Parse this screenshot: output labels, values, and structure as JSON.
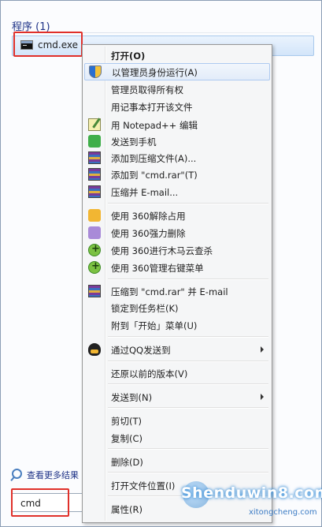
{
  "start_menu": {
    "section_header": "程序 (1)",
    "result_item": "cmd.exe",
    "see_more": "查看更多结果",
    "search_value": "cmd"
  },
  "context_menu": {
    "items": [
      {
        "label": "打开(O)",
        "icon": "",
        "bold": true
      },
      {
        "label": "以管理员身份运行(A)",
        "icon": "uac-shield-icon",
        "highlighted": true
      },
      {
        "label": "管理员取得所有权",
        "icon": ""
      },
      {
        "label": "用记事本打开该文件",
        "icon": ""
      },
      {
        "label": "用 Notepad++ 编辑",
        "icon": "notepad-plus-icon"
      },
      {
        "label": "发送到手机",
        "icon": "send-to-phone-icon"
      },
      {
        "label": "添加到压缩文件(A)...",
        "icon": "winrar-icon"
      },
      {
        "label": "添加到 \"cmd.rar\"(T)",
        "icon": "winrar-icon"
      },
      {
        "label": "压缩并 E-mail...",
        "icon": "winrar-icon"
      },
      {
        "label": "使用 360解除占用",
        "icon": "360-unlock-icon"
      },
      {
        "label": "使用 360强力删除",
        "icon": "360-shred-icon"
      },
      {
        "label": "使用 360进行木马云查杀",
        "icon": "360-scan-icon"
      },
      {
        "label": "使用 360管理右键菜单",
        "icon": "360-menu-icon"
      },
      {
        "label": "压缩到 \"cmd.rar\" 并 E-mail",
        "icon": "winrar-icon"
      },
      {
        "label": "锁定到任务栏(K)",
        "icon": ""
      },
      {
        "label": "附到「开始」菜单(U)",
        "icon": ""
      },
      {
        "label": "通过QQ发送到",
        "icon": "qq-icon",
        "submenu": true
      },
      {
        "label": "还原以前的版本(V)",
        "icon": ""
      },
      {
        "label": "发送到(N)",
        "icon": "",
        "submenu": true
      },
      {
        "label": "剪切(T)",
        "icon": ""
      },
      {
        "label": "复制(C)",
        "icon": ""
      },
      {
        "label": "删除(D)",
        "icon": ""
      },
      {
        "label": "打开文件位置(I)",
        "icon": ""
      },
      {
        "label": "属性(R)",
        "icon": ""
      }
    ]
  },
  "watermark": {
    "main": "Shenduwin8.com",
    "sub": "xitongcheng.com"
  },
  "colors": {
    "highlight_box": "#e0302a",
    "menu_bg": "#f5f6f7",
    "link_blue": "#1e3287"
  }
}
